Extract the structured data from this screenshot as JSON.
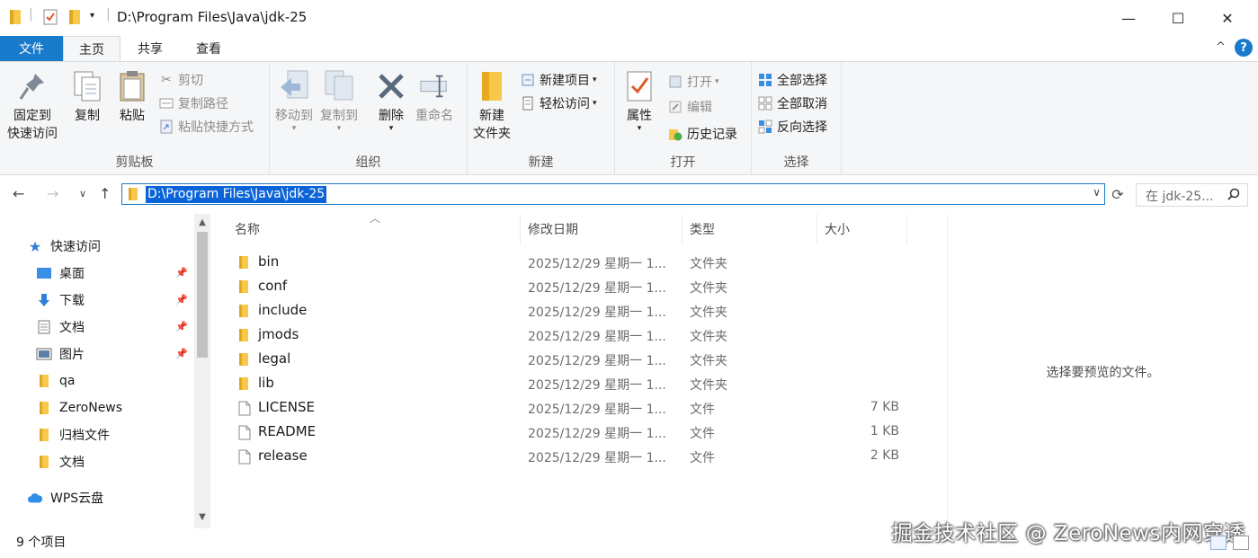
{
  "window": {
    "title": "D:\\Program Files\\Java\\jdk-25",
    "minimize": "—",
    "maximize": "☐",
    "close": "✕"
  },
  "ribbon_tabs": {
    "file": "文件",
    "home": "主页",
    "share": "共享",
    "view": "查看",
    "collapse": "^",
    "help": "?"
  },
  "ribbon": {
    "clipboard": {
      "label": "剪贴板",
      "pin": [
        "固定到",
        "快速访问"
      ],
      "copy": "复制",
      "paste": "粘贴",
      "cut": "剪切",
      "copy_path": "复制路径",
      "paste_shortcut": "粘贴快捷方式"
    },
    "organize": {
      "label": "组织",
      "move_to": "移动到",
      "copy_to": "复制到",
      "delete": "删除",
      "rename": "重命名"
    },
    "new": {
      "label": "新建",
      "new_folder": [
        "新建",
        "文件夹"
      ],
      "new_item": "新建项目",
      "easy_access": "轻松访问"
    },
    "open": {
      "label": "打开",
      "properties": "属性",
      "open": "打开",
      "edit": "编辑",
      "history": "历史记录"
    },
    "select": {
      "label": "选择",
      "select_all": "全部选择",
      "select_none": "全部取消",
      "invert": "反向选择"
    }
  },
  "address_bar": {
    "path": "D:\\Program Files\\Java\\jdk-25",
    "search_placeholder": "在 jdk-25..."
  },
  "sidebar": {
    "items": [
      {
        "label": "快速访问",
        "icon": "star-icon"
      },
      {
        "label": "桌面",
        "icon": "desktop-icon",
        "pinned": true
      },
      {
        "label": "下载",
        "icon": "download-icon",
        "pinned": true
      },
      {
        "label": "文档",
        "icon": "document-icon",
        "pinned": true
      },
      {
        "label": "图片",
        "icon": "picture-icon",
        "pinned": true
      },
      {
        "label": "qa",
        "icon": "folder-icon"
      },
      {
        "label": "ZeroNews",
        "icon": "folder-icon"
      },
      {
        "label": "归档文件",
        "icon": "folder-icon"
      },
      {
        "label": "文档",
        "icon": "folder-icon"
      },
      {
        "label": "WPS云盘",
        "icon": "cloud-icon"
      }
    ]
  },
  "columns": {
    "name": "名称",
    "date": "修改日期",
    "type": "类型",
    "size": "大小"
  },
  "files": [
    {
      "name": "bin",
      "date": "2025/12/29 星期一 1...",
      "type": "文件夹",
      "size": "",
      "kind": "folder"
    },
    {
      "name": "conf",
      "date": "2025/12/29 星期一 1...",
      "type": "文件夹",
      "size": "",
      "kind": "folder"
    },
    {
      "name": "include",
      "date": "2025/12/29 星期一 1...",
      "type": "文件夹",
      "size": "",
      "kind": "folder"
    },
    {
      "name": "jmods",
      "date": "2025/12/29 星期一 1...",
      "type": "文件夹",
      "size": "",
      "kind": "folder"
    },
    {
      "name": "legal",
      "date": "2025/12/29 星期一 1...",
      "type": "文件夹",
      "size": "",
      "kind": "folder"
    },
    {
      "name": "lib",
      "date": "2025/12/29 星期一 1...",
      "type": "文件夹",
      "size": "",
      "kind": "folder"
    },
    {
      "name": "LICENSE",
      "date": "2025/12/29 星期一 1...",
      "type": "文件",
      "size": "7 KB",
      "kind": "file"
    },
    {
      "name": "README",
      "date": "2025/12/29 星期一 1...",
      "type": "文件",
      "size": "1 KB",
      "kind": "file"
    },
    {
      "name": "release",
      "date": "2025/12/29 星期一 1...",
      "type": "文件",
      "size": "2 KB",
      "kind": "file"
    }
  ],
  "preview": {
    "empty_text": "选择要预览的文件。"
  },
  "status": {
    "item_count": "9 个项目",
    "watermark": "掘金技术社区 @ ZeroNews内网穿透"
  },
  "colors": {
    "accent": "#1979ca",
    "selection": "#0a64d8",
    "folder": "#f8c84a",
    "ribbon_bg": "#f5f6f7"
  }
}
